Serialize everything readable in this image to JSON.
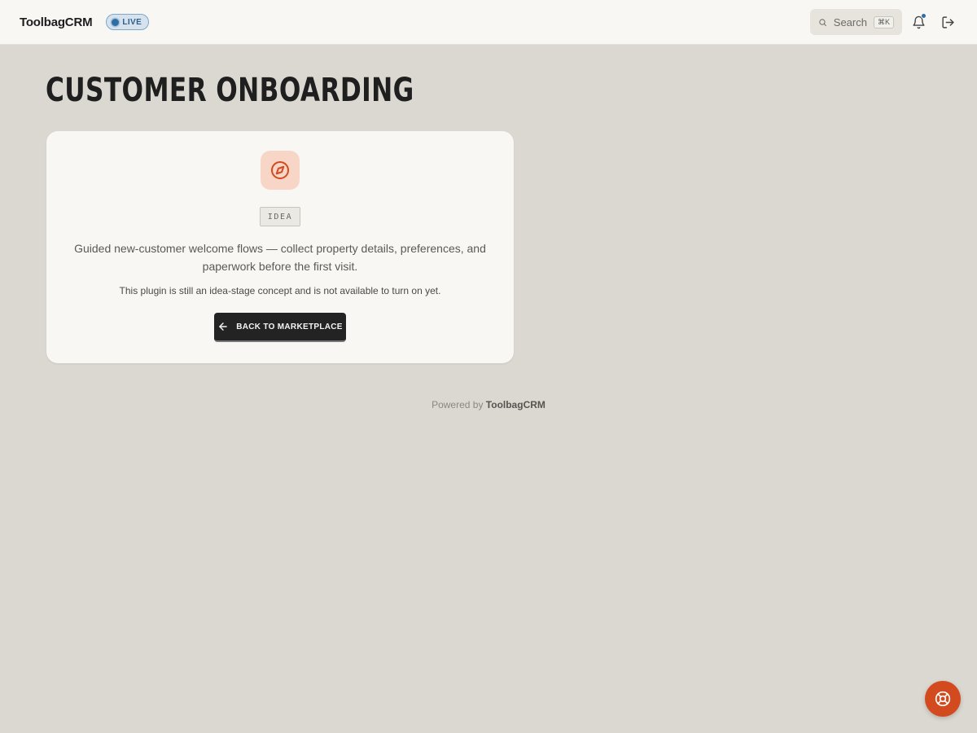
{
  "header": {
    "brand": "ToolbagCRM",
    "status_badge": "LIVE",
    "search": {
      "label": "Search",
      "shortcut": "⌘K"
    },
    "icons": {
      "search": "search-icon",
      "bell": "bell-icon",
      "logout": "logout-icon"
    }
  },
  "page": {
    "title": "CUSTOMER ONBOARDING"
  },
  "card": {
    "icon": "compass-icon",
    "tag": "IDEA",
    "description": "Guided new-customer welcome flows — collect property details, preferences, and paperwork before the first visit.",
    "note": "This plugin is still an idea-stage concept and is not available to turn on yet.",
    "back_button": "BACK TO MARKETPLACE"
  },
  "footer": {
    "prefix": "Powered by",
    "brand": "ToolbagCRM"
  },
  "help": {
    "icon": "lifebuoy-icon"
  },
  "colors": {
    "accent": "#d24a1e",
    "live": "#2f6ea5",
    "background": "#dbd8d1",
    "card": "#f8f7f4"
  }
}
